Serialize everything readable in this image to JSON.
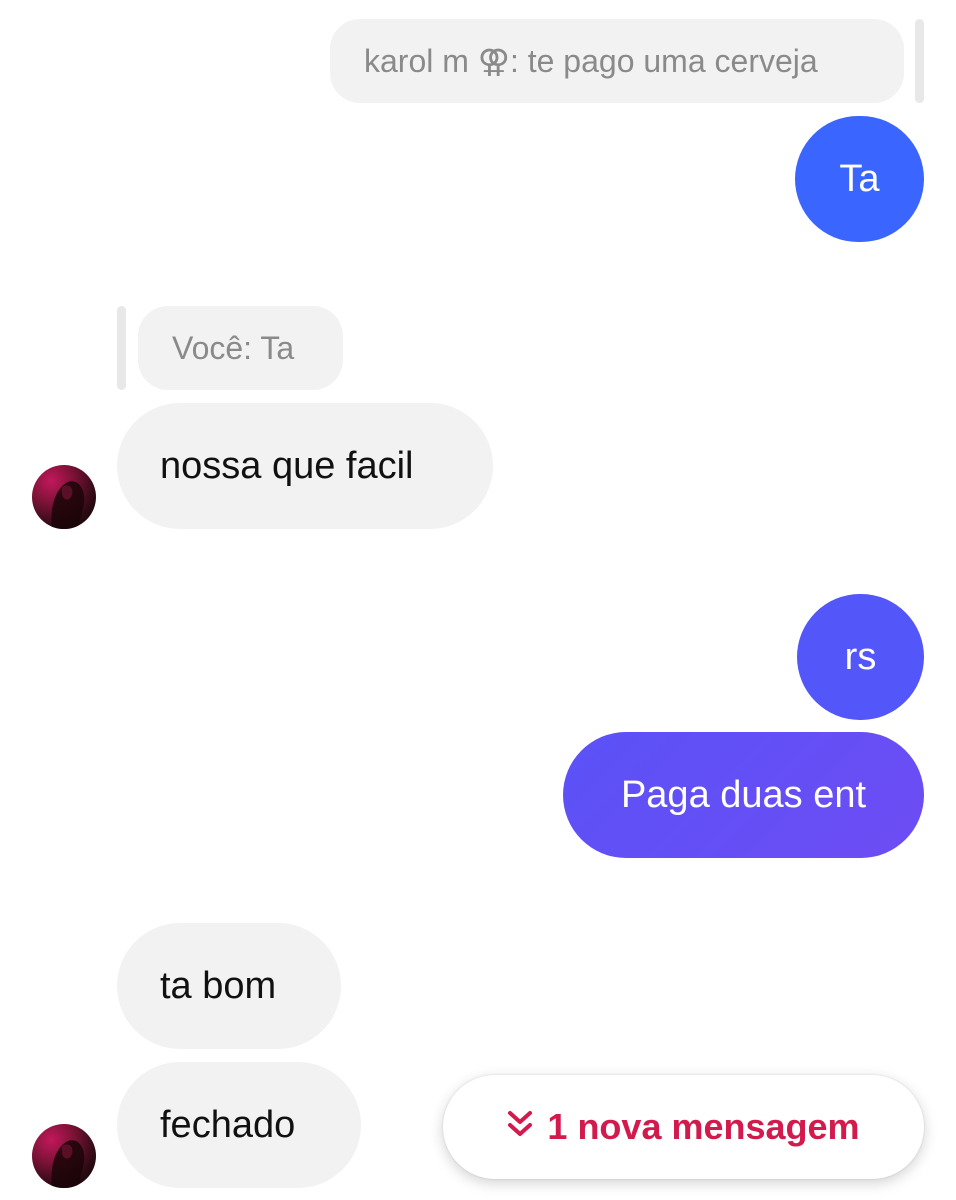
{
  "thread": {
    "messages": [
      {
        "id": "q1",
        "kind": "reply-quote",
        "text": "karol m ⚢: te pago uma cerveja"
      },
      {
        "id": "m1",
        "kind": "outgoing",
        "text": "Ta"
      },
      {
        "id": "q2",
        "kind": "reply-quote",
        "text": "Você: Ta"
      },
      {
        "id": "m2",
        "kind": "incoming",
        "text": "nossa que facil"
      },
      {
        "id": "m3",
        "kind": "outgoing",
        "text": "rs"
      },
      {
        "id": "m4",
        "kind": "outgoing",
        "text": "Paga duas ent"
      },
      {
        "id": "m5",
        "kind": "incoming",
        "text": "ta bom"
      },
      {
        "id": "m6",
        "kind": "incoming",
        "text": "fechado"
      }
    ]
  },
  "new_message_pill": {
    "icon": "double-chevron-down-icon",
    "label": "1 nova mensagem"
  },
  "colors": {
    "outgoing_gradient": [
      "#3a66ff",
      "#5a52f7",
      "#7a47f2"
    ],
    "incoming_bg": "#f2f2f2",
    "quote_text": "#8a8a8a",
    "pill_accent": "#d21a4d"
  }
}
